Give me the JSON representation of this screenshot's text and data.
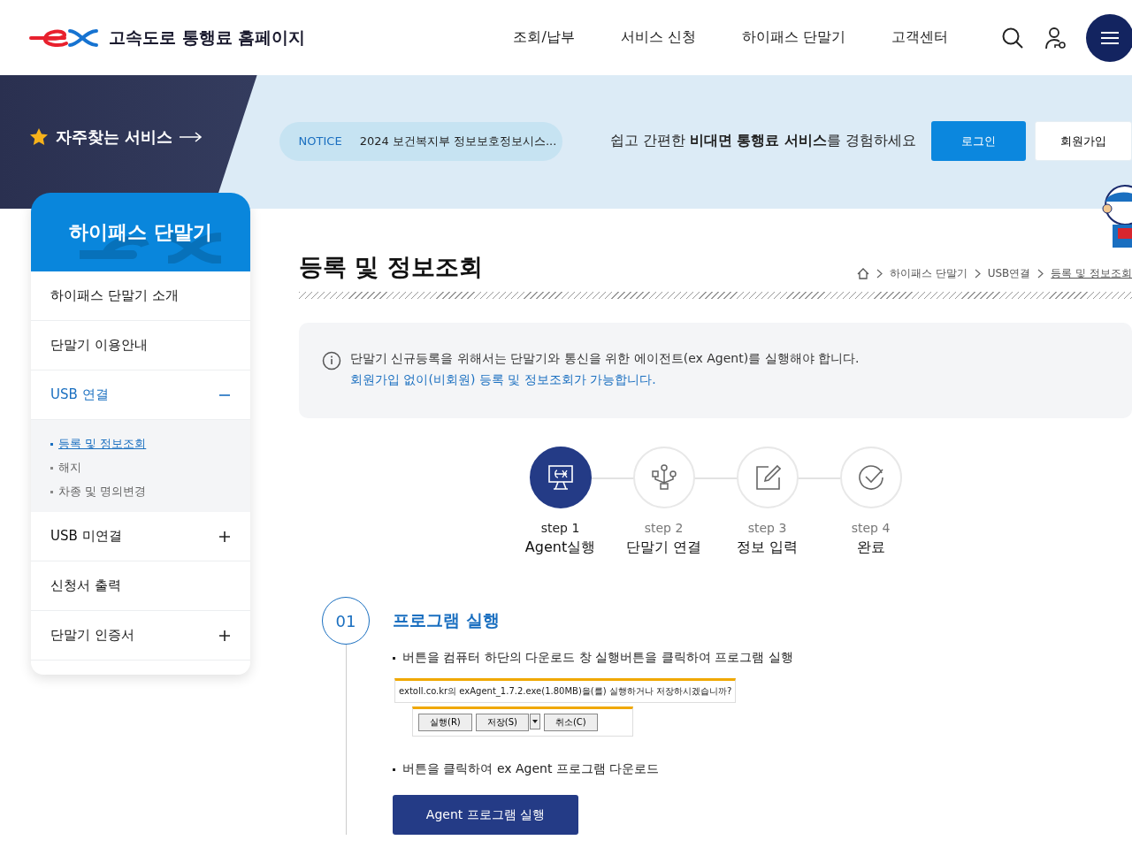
{
  "header": {
    "site_title": "고속도로 통행료 홈페이지",
    "nav": [
      {
        "label": "조회/납부"
      },
      {
        "label": "서비스 신청"
      },
      {
        "label": "하이패스 단말기"
      },
      {
        "label": "고객센터"
      }
    ]
  },
  "banner": {
    "favorites": "자주찾는 서비스",
    "notice": {
      "tag": "NOTICE",
      "text": "2024 보건복지부 정보보호정보시스..."
    },
    "tagline": "쉽고 간편한 **비대면 통행료 서비스**를 경험하세요",
    "login": "로그인",
    "signup": "회원가입"
  },
  "sidebar": {
    "title": "하이패스 단말기",
    "items": [
      {
        "label": "하이패스 단말기 소개",
        "kind": "link",
        "selected": false
      },
      {
        "label": "단말기 이용안내",
        "kind": "link",
        "selected": false
      },
      {
        "label": "USB 연결",
        "kind": "group",
        "selected": true,
        "expanded": true,
        "children": [
          {
            "label": "등록 및 정보조회",
            "selected": true
          },
          {
            "label": "해지",
            "selected": false
          },
          {
            "label": "차종 및 명의변경",
            "selected": false
          }
        ]
      },
      {
        "label": "USB 미연결",
        "kind": "group",
        "selected": false,
        "expanded": false
      },
      {
        "label": "신청서 출력",
        "kind": "link",
        "selected": false
      },
      {
        "label": "단말기 인증서",
        "kind": "group",
        "selected": false,
        "expanded": false
      }
    ]
  },
  "page": {
    "title": "등록 및 정보조회",
    "breadcrumb": [
      {
        "label": "하이패스 단말기"
      },
      {
        "label": "USB연결"
      },
      {
        "label": "등록 및 정보조회",
        "current": true
      }
    ],
    "info": [
      "단말기 신규등록을 위해서는 단말기와 통신을 위한 에이전트(ex Agent)를 실행해야 합니다.",
      "회원가입 없이(비회원) 등록 및 정보조회가 가능합니다."
    ],
    "steps": [
      {
        "kind": "monitor",
        "step": "step 1",
        "label": "Agent실행",
        "selected": true
      },
      {
        "kind": "usb",
        "step": "step 2",
        "label": "단말기 연결",
        "selected": false
      },
      {
        "kind": "edit",
        "step": "step 3",
        "label": "정보 입력",
        "selected": false
      },
      {
        "kind": "check",
        "step": "step 4",
        "label": "완료",
        "selected": false
      }
    ],
    "section": {
      "number": "01",
      "title": "프로그램 실행",
      "bullets": [
        {
          "text": "버튼을 컴퓨터 하단의 다운로드 창 실행버튼을 클릭하여 프로그램 실행",
          "kind": "dialog"
        },
        {
          "text": "버튼을 클릭하여 ex Agent 프로그램 다운로드",
          "kind": "button"
        }
      ],
      "dialog": {
        "message": "extoll.co.kr의 exAgent_1.7.2.exe(1.80MB)을(를) 실행하거나 저장하시겠습니까?",
        "buttons": [
          "실행(R)",
          "저장(S)",
          "취소(C)"
        ]
      },
      "action": "Agent 프로그램 실행"
    }
  }
}
